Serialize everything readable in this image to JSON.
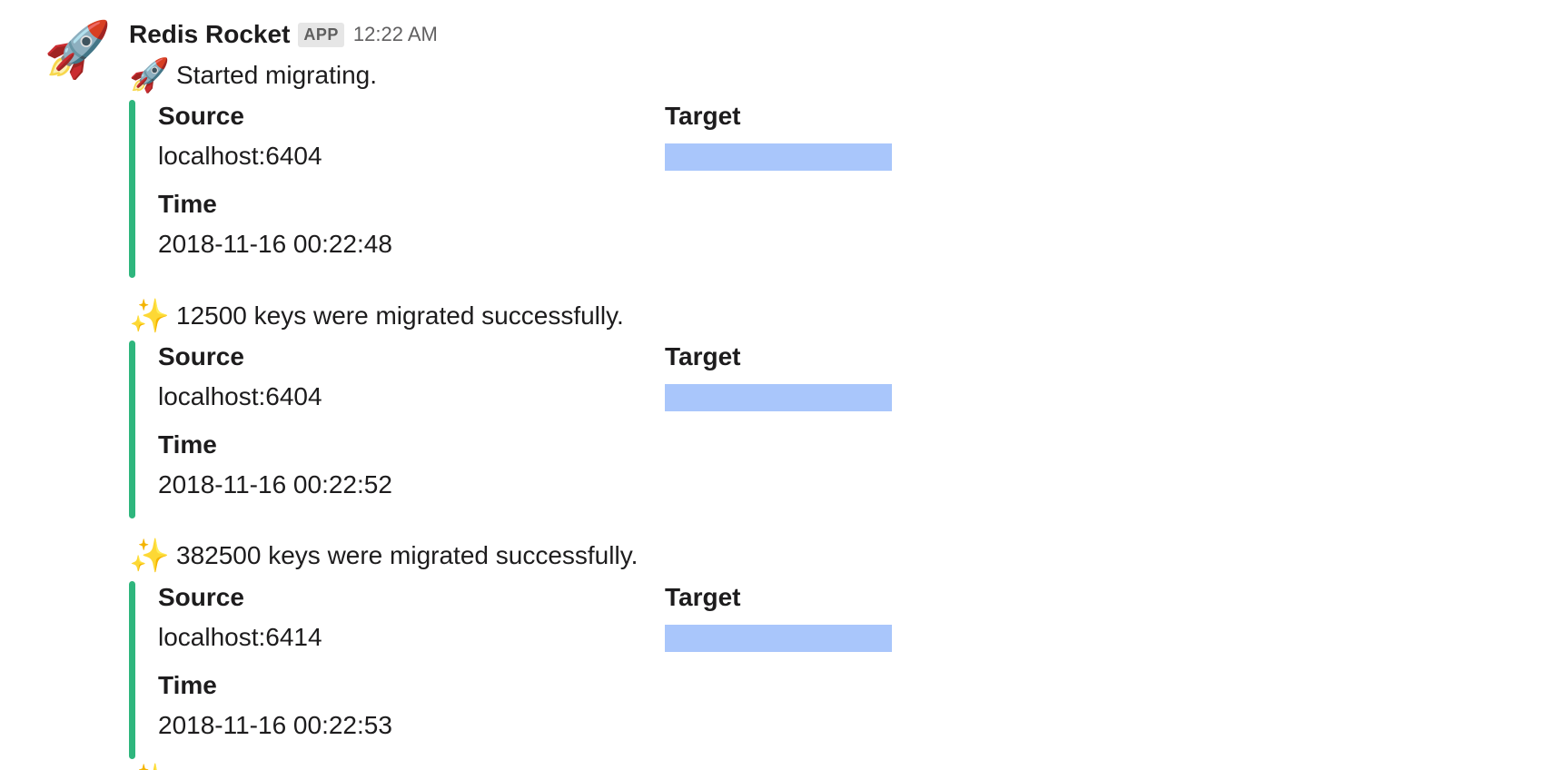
{
  "message": {
    "avatar_icon": "rocket-icon",
    "avatar_glyph": "🚀",
    "sender": "Redis Rocket",
    "badge": "APP",
    "timestamp": "12:22 AM",
    "items": [
      {
        "emoji": "🚀",
        "emoji_icon": "rocket-icon",
        "text": "Started migrating.",
        "fields": {
          "source_title": "Source",
          "source_value": "localhost:6404",
          "target_title": "Target",
          "target_value_redacted": true,
          "time_title": "Time",
          "time_value": "2018-11-16 00:22:48"
        }
      },
      {
        "emoji": "✨",
        "emoji_icon": "sparkles-icon",
        "text": "12500 keys were migrated successfully.",
        "fields": {
          "source_title": "Source",
          "source_value": "localhost:6404",
          "target_title": "Target",
          "target_value_redacted": true,
          "time_title": "Time",
          "time_value": "2018-11-16 00:22:52"
        }
      },
      {
        "emoji": "✨",
        "emoji_icon": "sparkles-icon",
        "text": "382500 keys were migrated successfully.",
        "fields": {
          "source_title": "Source",
          "source_value": "localhost:6414",
          "target_title": "Target",
          "target_value_redacted": true,
          "time_title": "Time",
          "time_value": "2018-11-16 00:22:53"
        }
      }
    ],
    "next_emoji": "✨"
  },
  "colors": {
    "attachment_bar": "#2eb67d",
    "redacted_block": "#a9c6fb",
    "badge_bg": "#e6e6e6",
    "timestamp": "#616061"
  }
}
